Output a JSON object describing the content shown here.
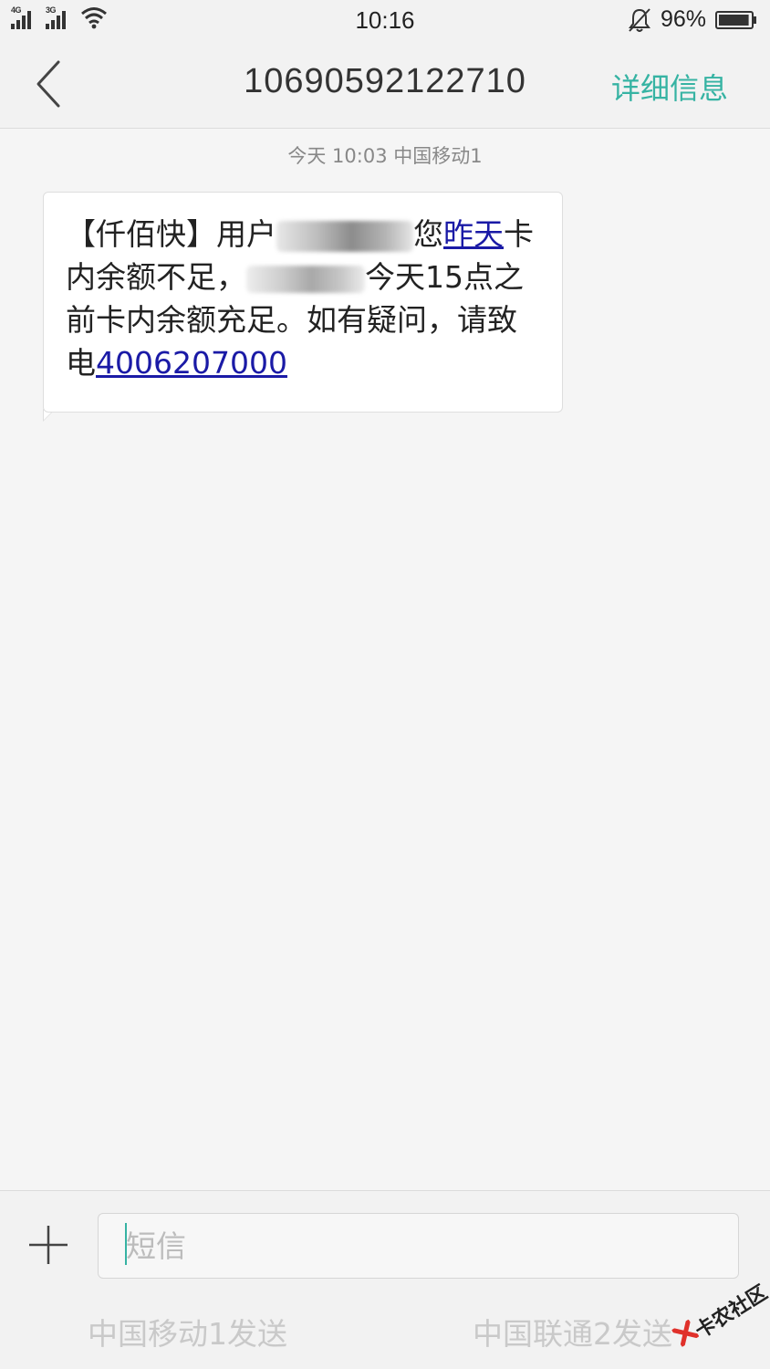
{
  "status_bar": {
    "sim1_network": "4G",
    "sim2_network": "3G",
    "time": "10:16",
    "battery_percent": "96%",
    "battery_level": 0.96,
    "icons": [
      "signal-icon",
      "wifi-icon",
      "alarm-bell-icon",
      "battery-icon"
    ]
  },
  "header": {
    "title": "10690592122710",
    "detail_label": "详细信息",
    "back_icon": "chevron-left-icon"
  },
  "conversation": {
    "meta": "今天  10:03  中国移动1",
    "message": {
      "part1": "【仟佰快】用户",
      "part2": "您",
      "link_date": "昨天",
      "part3": "卡内余额不足，",
      "part4": "今天15点之前卡内余额充足。如有疑问，请致电",
      "link_phone": "4006207000"
    }
  },
  "composer": {
    "placeholder": "短信",
    "send_sim1": "中国移动1发送",
    "send_sim2": "中国联通2发送",
    "add_icon": "plus-icon"
  },
  "watermark": {
    "text": "卡农社区"
  },
  "colors": {
    "accent": "#36b3a3",
    "link": "#1a1aa6",
    "background": "#f5f5f5"
  }
}
